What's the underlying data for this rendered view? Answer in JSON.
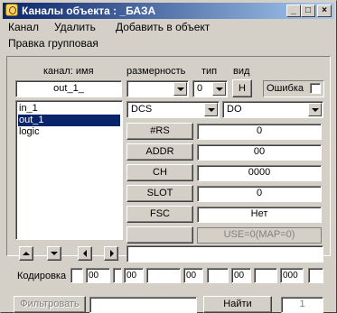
{
  "window": {
    "title": "Каналы объекта : _БАЗА",
    "minimize": "_",
    "maximize": "□",
    "close": "×"
  },
  "menu": {
    "items": [
      "Канал",
      "Удалить",
      "Добавить в объект"
    ],
    "row2": "Правка групповая"
  },
  "header": {
    "channel_label": "канал: имя",
    "dimension_label": "размерность",
    "type_label": "тип",
    "view_label": "вид",
    "channel_name": "out_1_",
    "dimension_value": "",
    "type_value": "0",
    "view_button": "Н",
    "error_label": "Ошибка",
    "error_checked": false
  },
  "channels": {
    "items": [
      "in_1",
      "out_1",
      "logic"
    ],
    "selected": "out_1"
  },
  "device": {
    "driver": "DCS",
    "mode": "DO"
  },
  "params": [
    {
      "name": "#RS",
      "value": "0"
    },
    {
      "name": "ADDR",
      "value": "00"
    },
    {
      "name": "CH",
      "value": "0000"
    },
    {
      "name": "SLOT",
      "value": "0"
    },
    {
      "name": "FSC",
      "value": "Нет"
    }
  ],
  "extra": {
    "button": "",
    "value": "USE=0(MAP=0)"
  },
  "nav": {
    "bottom_field": ""
  },
  "encoding": {
    "label": "Кодировка",
    "fields": [
      "",
      "00",
      "",
      "00",
      "",
      "00",
      "",
      "00",
      "",
      "000",
      ""
    ]
  },
  "filter": {
    "button": "Фильтровать",
    "input": "",
    "find_button": "Найти",
    "count": "1"
  },
  "colors": {
    "face": "#d4d0c8",
    "title_start": "#0a246a",
    "title_end": "#a6caf0",
    "selection": "#0a246a"
  }
}
